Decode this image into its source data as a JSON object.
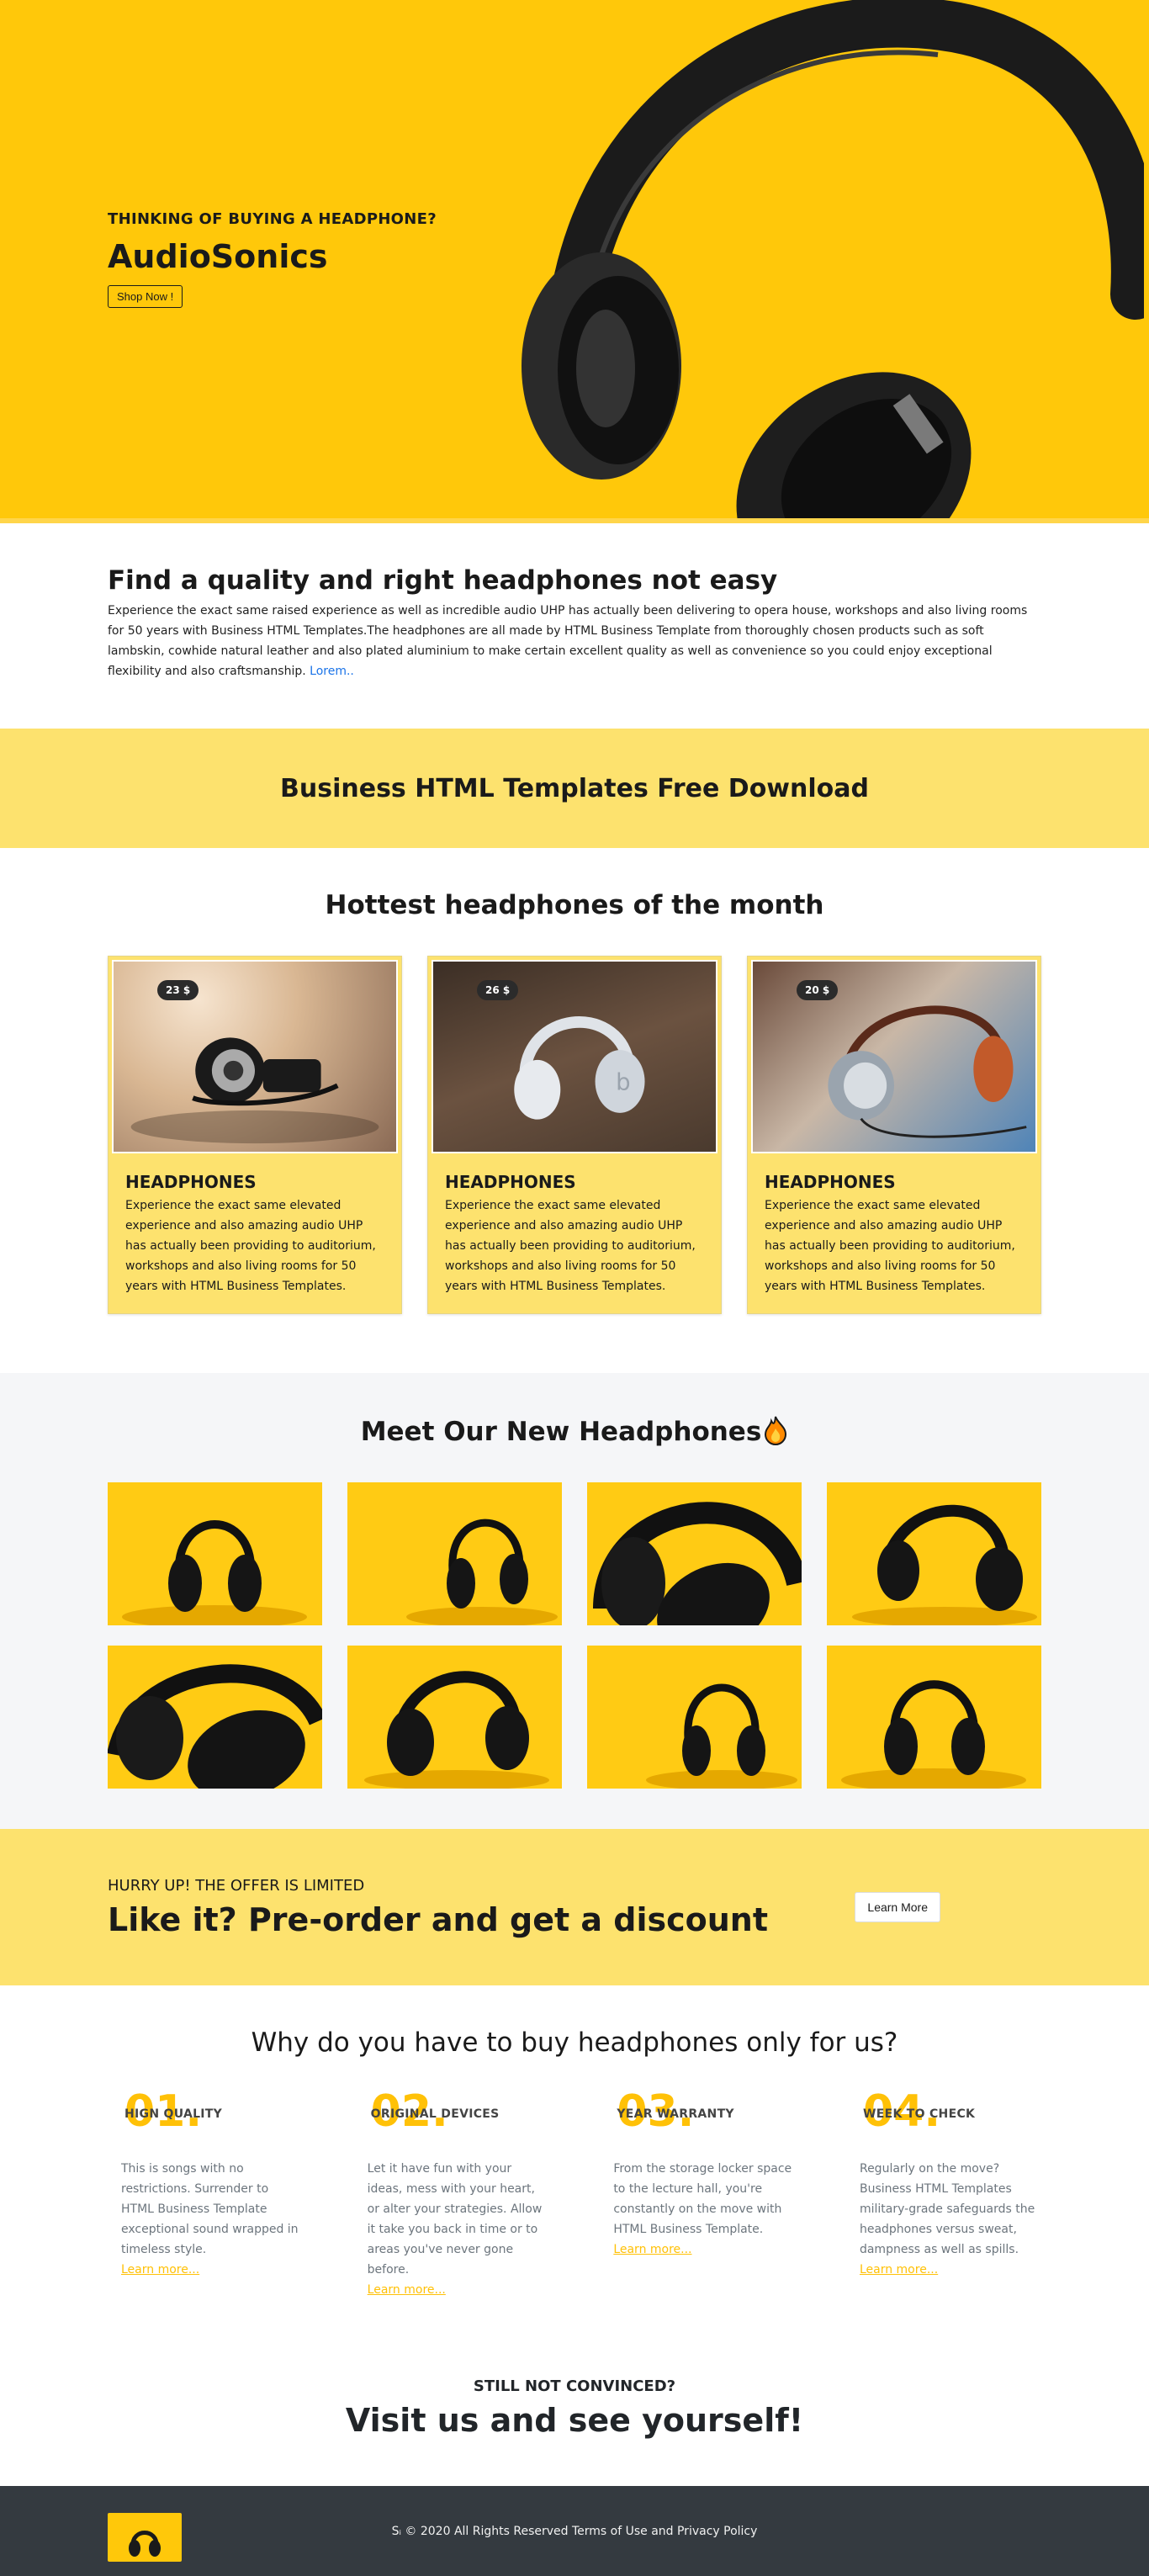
{
  "hero": {
    "kicker": "THINKING OF BUYING A HEADPHONE?",
    "title": "AudioSonics",
    "button": "Shop Now !"
  },
  "intro": {
    "title": "Find a quality and right headphones not easy",
    "body": "Experience the exact same raised experience as well as incredible audio UHP has actually been delivering to opera house, workshops and also living rooms for 50 years with Business HTML Templates.The headphones are all made by HTML Business Template from thoroughly chosen products such as soft lambskin, cowhide natural leather and also plated aluminium to make certain excellent quality as well as convenience so you could enjoy exceptional flexibility and also craftsmanship.",
    "link": "Lorem.."
  },
  "band": {
    "title": "Business HTML Templates Free Download"
  },
  "hottest": {
    "title": "Hottest headphones of the month",
    "cards": [
      {
        "price": "23 $",
        "title": "HEADPHONES",
        "text": "Experience the exact same elevated experience and also amazing audio UHP has actually been providing to auditorium, workshops and also living rooms for 50 years with HTML Business Templates."
      },
      {
        "price": "26 $",
        "title": "HEADPHONES",
        "text": "Experience the exact same elevated experience and also amazing audio UHP has actually been providing to auditorium, workshops and also living rooms for 50 years with HTML Business Templates."
      },
      {
        "price": "20 $",
        "title": "HEADPHONES",
        "text": "Experience the exact same elevated experience and also amazing audio UHP has actually been providing to auditorium, workshops and also living rooms for 50 years with HTML Business Templates."
      }
    ]
  },
  "new_headphones": {
    "title": "Meet Our New Headphones",
    "icon": "fire-icon"
  },
  "cta": {
    "kicker": "HURRY UP! THE OFFER IS LIMITED",
    "title": "Like it? Pre-order and get a discount",
    "button": "Learn More"
  },
  "why": {
    "title": "Why do you have to buy headphones only for us?",
    "features": [
      {
        "num": "01.",
        "title": "HIGN QUALITY",
        "text": "This is songs with no restrictions. Surrender to HTML Business Template exceptional sound wrapped in timeless style.",
        "link": "Learn more..."
      },
      {
        "num": "02.",
        "title": "ORIGINAL DEVICES",
        "text": "Let it have fun with your ideas, mess with your heart, or alter your strategies. Allow it take you back in time or to areas you've never gone before.",
        "link": "Learn more..."
      },
      {
        "num": "03.",
        "title": "YEAR WARRANTY",
        "text": "From the storage locker space to the lecture hall, you're constantly on the move with HTML Business Template.",
        "link": "Learn more..."
      },
      {
        "num": "04.",
        "title": "WEEK TO CHECK",
        "text": "Regularly on the move? Business HTML Templates military-grade safeguards the headphones versus sweat, dampness as well as spills.",
        "link": "Learn more..."
      }
    ]
  },
  "visit": {
    "kicker": "STILL NOT CONVINCED?",
    "title": "Visit us and see yourself!"
  },
  "footer": {
    "text": "Sᵢ © 2020 All Rights Reserved Terms of Use and Privacy Policy"
  },
  "colors": {
    "brand_yellow": "#ffc80a",
    "light_yellow": "#fde26e",
    "accent": "#ffc107",
    "dark": "#343a40"
  }
}
